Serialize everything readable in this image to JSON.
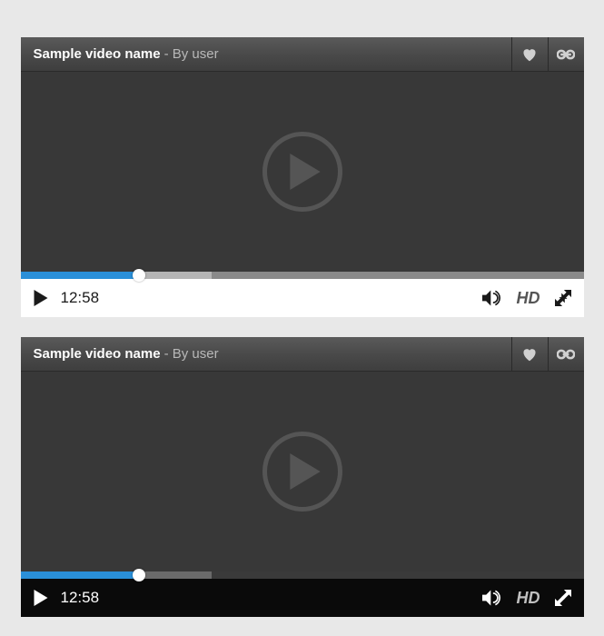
{
  "players": [
    {
      "theme": "light",
      "title": "Sample video name",
      "byline": "- By user",
      "timestamp": "12:58",
      "hd_label": "HD",
      "progress": {
        "played_percent": 21,
        "buffered_percent": 34
      },
      "colors": {
        "accent": "#2a8fd8",
        "control_bg": "#ffffff",
        "control_fg": "#1a1a1a"
      }
    },
    {
      "theme": "dark",
      "title": "Sample video name",
      "byline": "- By user",
      "timestamp": "12:58",
      "hd_label": "HD",
      "progress": {
        "played_percent": 21,
        "buffered_percent": 34
      },
      "colors": {
        "accent": "#2a8fd8",
        "control_bg": "#0a0a0a",
        "control_fg": "#ffffff"
      }
    }
  ]
}
